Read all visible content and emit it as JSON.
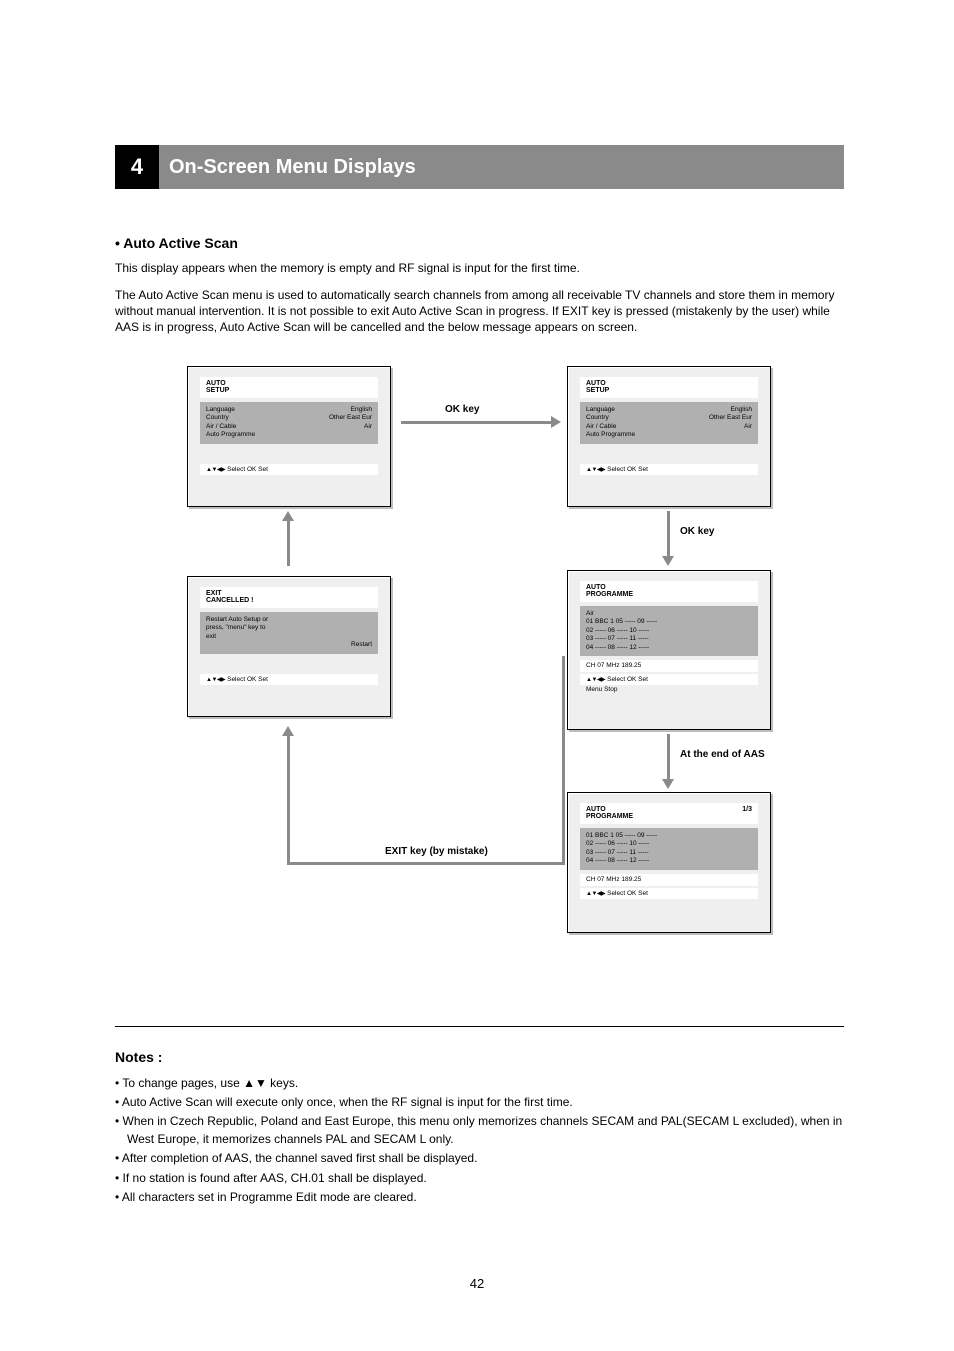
{
  "header": {
    "number": "4",
    "title": "On-Screen Menu Displays"
  },
  "aas": {
    "title": "• Auto Active Scan",
    "sub": "This display appears when the memory is empty and RF signal is input for the first time.",
    "intro": "The Auto Active Scan menu is used to automatically search channels from among all receivable TV channels and store them in memory without manual intervention. It is not possible to exit Auto Active Scan in progress. If EXIT key is pressed (mistakenly by the user) while AAS is in progress, Auto Active Scan will be cancelled and the below message appears on screen."
  },
  "panels": {
    "p1": {
      "title": "AUTO\nSETUP",
      "box_lines": [
        {
          "l": "Language",
          "r": "English"
        },
        {
          "l": "Country",
          "r": "Other East Eur"
        },
        {
          "l": "Air / Cable",
          "r": "Air"
        },
        {
          "l": "Auto Programme",
          "r": ""
        }
      ],
      "bar3": "      Select        OK Set"
    },
    "p2": {
      "title": "EXIT\nCANCELLED !",
      "box_lines": [
        {
          "l": "Restart Auto Setup or",
          "r": ""
        },
        {
          "l": "press, \"menu\" key to",
          "r": ""
        },
        {
          "l": "exit",
          "r": ""
        },
        {
          "l": "",
          "r": "Restart"
        }
      ],
      "bar3": "      Select        OK Set"
    },
    "p3": {
      "title": "AUTO\nSETUP",
      "box_lines": [
        {
          "l": "Language",
          "r": "English"
        },
        {
          "l": "Country",
          "r": "Other East Eur"
        },
        {
          "l": "Air / Cable",
          "r": "Air"
        },
        {
          "l": "Auto Programme",
          "r": ""
        }
      ],
      "bar3": "      Select        OK Set"
    },
    "p4": {
      "title": "AUTO\nPROGRAMME",
      "box_lines": [
        {
          "l": "Air",
          "r": ""
        },
        {
          "l": "01 BBC 1  05 -----  09 -----",
          "r": ""
        },
        {
          "l": "02 -----  06 -----  10 -----",
          "r": ""
        },
        {
          "l": "03 -----  07 -----  11 -----",
          "r": ""
        },
        {
          "l": "04 -----  08 -----  12 -----",
          "r": ""
        }
      ],
      "extra": "CH 07         MHz 189.25",
      "bar3": "      Select        OK Set",
      "bar3b": "Menu Stop"
    },
    "p5": {
      "title": "AUTO\nPROGRAMME",
      "small": "1/3",
      "box_lines": [
        {
          "l": "01 BBC 1  05 -----  09 -----",
          "r": ""
        },
        {
          "l": "02 -----  06 -----  10 -----",
          "r": ""
        },
        {
          "l": "03 -----  07 -----  11 -----",
          "r": ""
        },
        {
          "l": "04 -----  08 -----  12 -----",
          "r": ""
        }
      ],
      "extra": "CH 07         MHz 189.25",
      "bar3": "      Select        OK Set"
    }
  },
  "captions": {
    "c1": "OK key",
    "c2": "OK key",
    "c3": "At the end of AAS",
    "c4": "EXIT key (by mistake)"
  },
  "notes": {
    "title": "Notes :",
    "lines": [
      "• To change pages, use    keys.",
      "• Auto Active Scan will execute only once, when the RF signal is input for the first time.",
      "• When in Czech Republic, Poland and East Europe, this menu only memorizes channels SECAM and PAL(SECAM L excluded), when in West Europe, it memorizes channels PAL and SECAM L only.",
      "• After completion of AAS, the channel saved first shall be displayed.",
      "• If no station is found after AAS, CH.01 shall be displayed.",
      "• All characters set in Programme Edit mode are cleared."
    ]
  },
  "page_number": "42",
  "icons": {
    "arrows4": "▲▼◀▶",
    "arrows2": "▲▼"
  }
}
